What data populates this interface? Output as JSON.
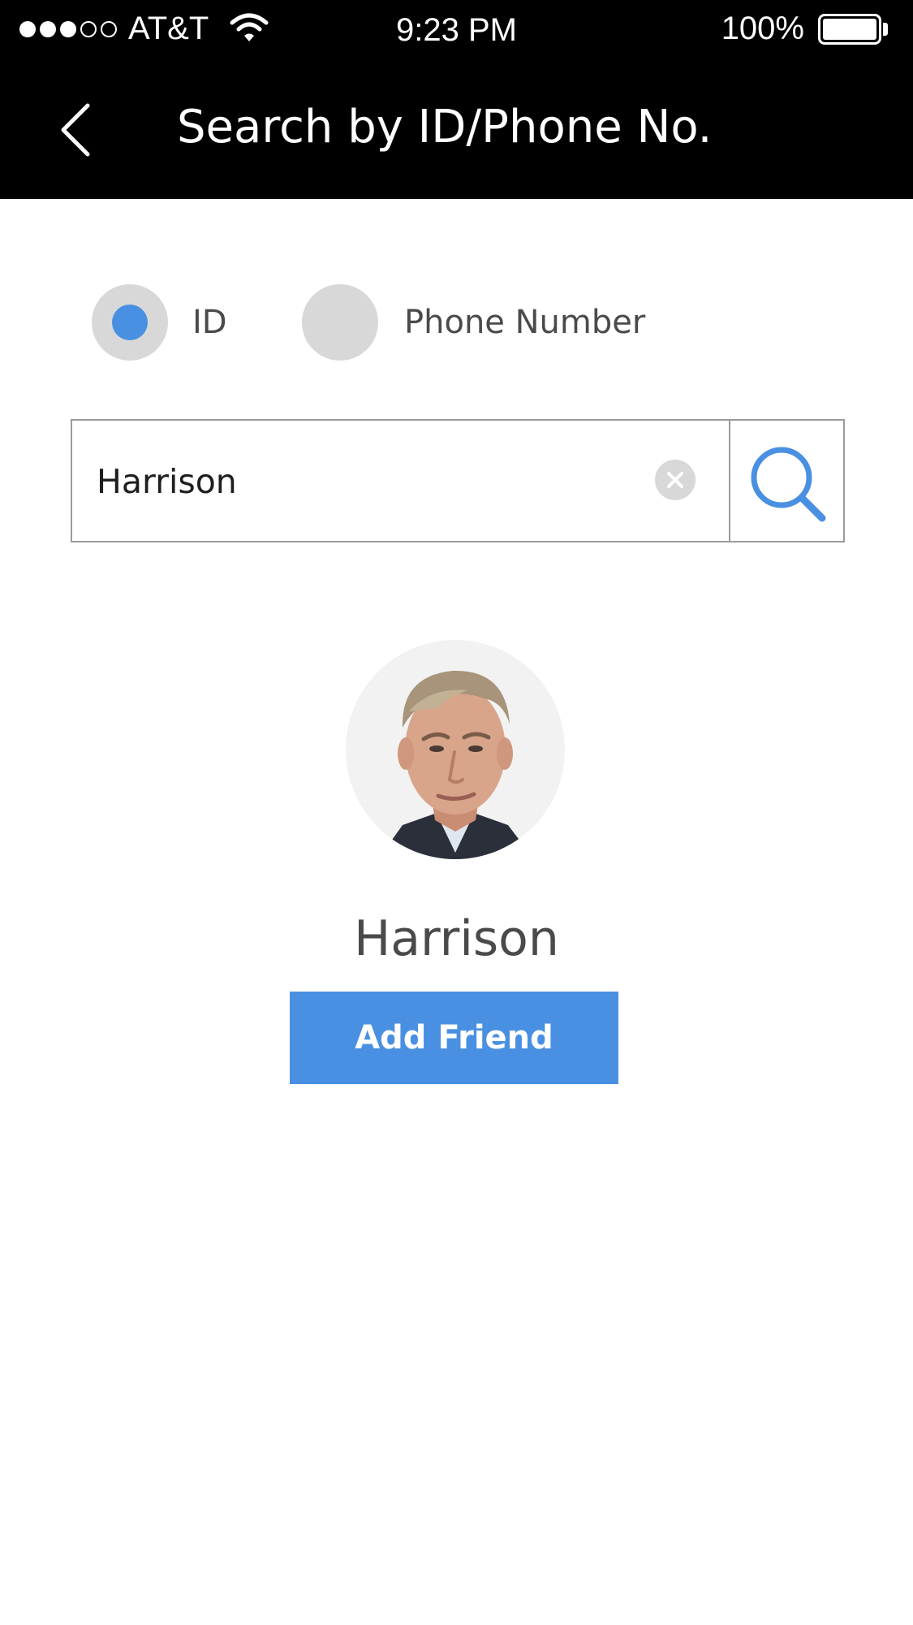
{
  "status_bar": {
    "signal_bars_filled": 3,
    "signal_bars_total": 5,
    "carrier": "AT&T",
    "time": "9:23 PM",
    "battery_percent": "100%",
    "battery_level": 1.0
  },
  "nav": {
    "back_icon": "chevron-left-icon",
    "title": "Search by ID/Phone No."
  },
  "search_mode": {
    "selected": "ID",
    "options": [
      {
        "label": "ID",
        "selected": true
      },
      {
        "label": "Phone Number",
        "selected": false
      }
    ]
  },
  "search": {
    "value": "Harrison",
    "clear_icon": "clear-icon",
    "search_icon": "search-icon"
  },
  "result": {
    "avatar_icon": "avatar",
    "name": "Harrison",
    "add_friend_label": "Add Friend"
  },
  "colors": {
    "accent": "#4a90e2",
    "bar_background": "#000000",
    "radio_background": "#d8d8d8",
    "text": "#4a4a4a",
    "border": "#9b9b9b"
  }
}
